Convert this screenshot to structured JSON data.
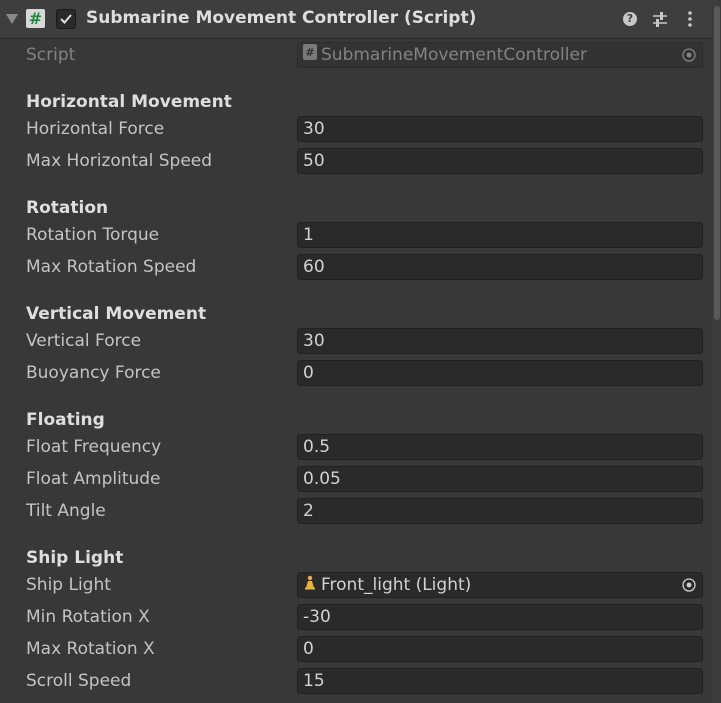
{
  "header": {
    "title": "Submarine Movement Controller (Script)",
    "icons": [
      "foldout-arrow-icon",
      "script-hash-icon",
      "checkbox-check-icon",
      "help-icon",
      "presets-icon",
      "kebab-menu-icon"
    ]
  },
  "script_row": {
    "label": "Script",
    "value": "SubmarineMovementController"
  },
  "horizontal": {
    "title": "Horizontal Movement",
    "force_label": "Horizontal Force",
    "force_value": "30",
    "max_speed_label": "Max Horizontal Speed",
    "max_speed_value": "50"
  },
  "rotation": {
    "title": "Rotation",
    "torque_label": "Rotation Torque",
    "torque_value": "1",
    "max_speed_label": "Max Rotation Speed",
    "max_speed_value": "60"
  },
  "vertical": {
    "title": "Vertical Movement",
    "force_label": "Vertical Force",
    "force_value": "30",
    "buoyancy_label": "Buoyancy Force",
    "buoyancy_value": "0"
  },
  "floating": {
    "title": "Floating",
    "frequency_label": "Float Frequency",
    "frequency_value": "0.5",
    "amplitude_label": "Float Amplitude",
    "amplitude_value": "0.05",
    "tilt_label": "Tilt Angle",
    "tilt_value": "2"
  },
  "ship_light": {
    "title": "Ship Light",
    "light_label": "Ship Light",
    "light_value": "Front_light (Light)",
    "min_rot_label": "Min Rotation X",
    "min_rot_value": "-30",
    "max_rot_label": "Max Rotation X",
    "max_rot_value": "0",
    "scroll_label": "Scroll Speed",
    "scroll_value": "15"
  },
  "colors": {
    "background": "#383838",
    "field": "#2a2a2a",
    "script_icon": "#1d8b3a",
    "light_icon": "#e8b43a"
  }
}
